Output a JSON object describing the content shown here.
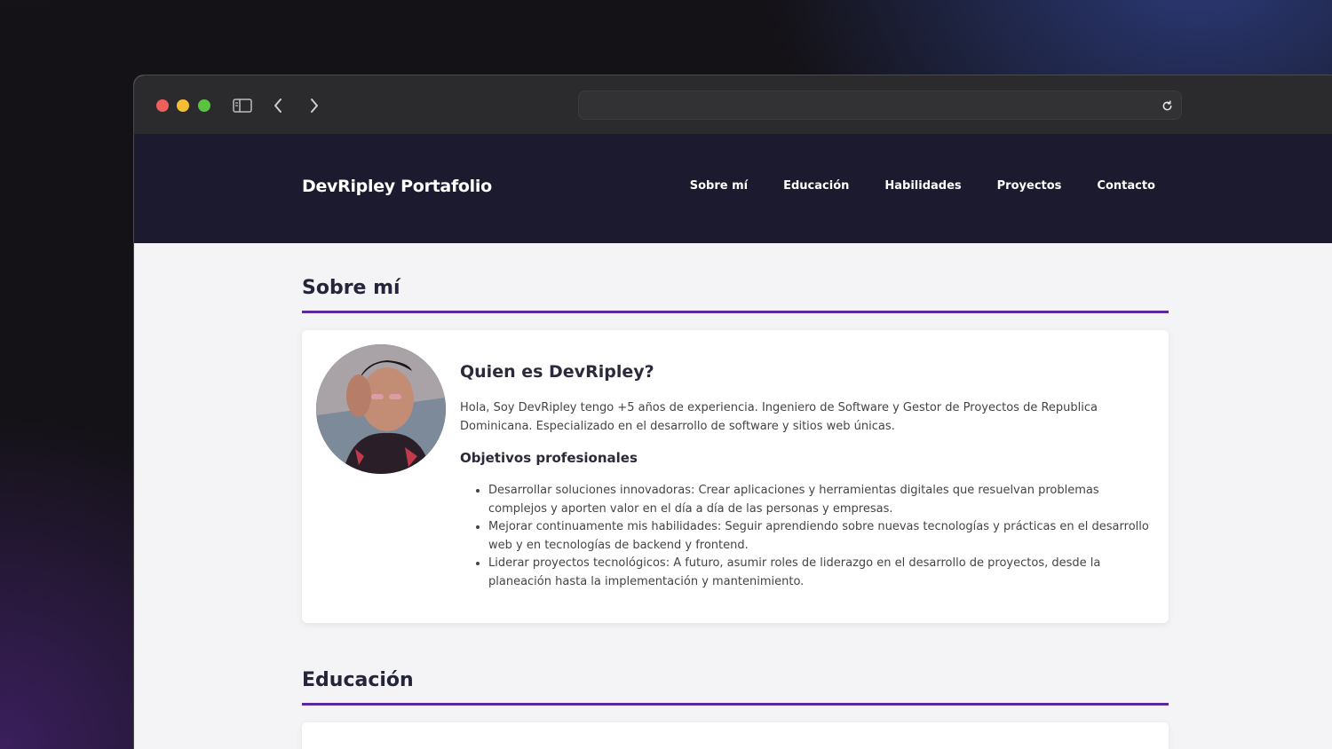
{
  "browser": {
    "url": ""
  },
  "header": {
    "brand": "DevRipley Portafolio",
    "nav": [
      "Sobre mí",
      "Educación",
      "Habilidades",
      "Proyectos",
      "Contacto"
    ]
  },
  "about": {
    "section_title": "Sobre mí",
    "card_title": "Quien es DevRipley?",
    "bio": "Hola, Soy DevRipley tengo +5 años de experiencia. Ingeniero de Software y Gestor de Proyectos de Republica Dominicana. Especializado en el desarrollo de software y sitios web únicas.",
    "goals_title": "Objetivos profesionales",
    "goals": [
      "Desarrollar soluciones innovadoras: Crear aplicaciones y herramientas digitales que resuelvan problemas complejos y aporten valor en el día a día de las personas y empresas.",
      "Mejorar continuamente mis habilidades: Seguir aprendiendo sobre nuevas tecnologías y prácticas en el desarrollo web y en tecnologías de backend y frontend.",
      "Liderar proyectos tecnológicos: A futuro, asumir roles de liderazgo en el desarrollo de proyectos, desde la planeación hasta la implementación y mantenimiento."
    ]
  },
  "education": {
    "section_title": "Educación"
  }
}
